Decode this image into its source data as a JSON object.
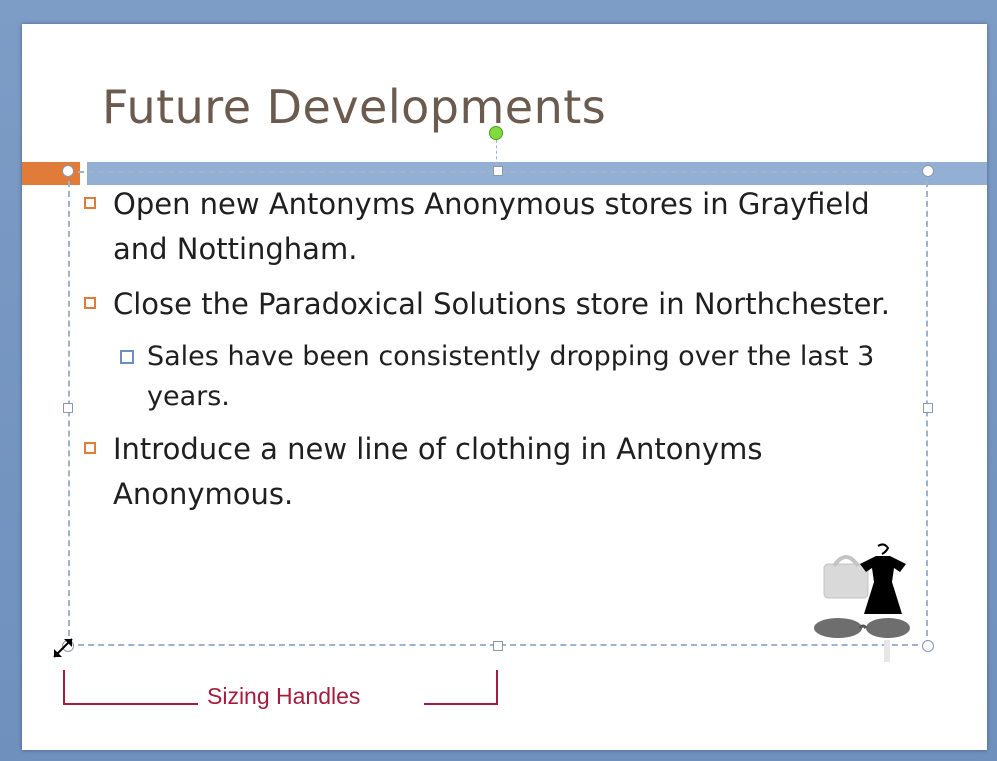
{
  "slide": {
    "title": "Future Developments",
    "bullets": [
      {
        "level": 1,
        "text": "Open new Antonyms Anonymous stores in Grayfield and Nottingham."
      },
      {
        "level": 1,
        "text": "Close the Paradoxical Solutions store in Northchester."
      },
      {
        "level": 2,
        "text": "Sales have been consistently dropping over the last 3 years."
      },
      {
        "level": 1,
        "text": "Introduce a new line of clothing in Antonyms Anonymous."
      }
    ],
    "clipart_icon": "clothing-clipart-icon"
  },
  "callout": {
    "label": "Sizing Handles"
  },
  "colors": {
    "title": "#6b5a4e",
    "accent_orange": "#e07b39",
    "accent_blue": "#93b0d4",
    "sub_bullet": "#6a8fc0",
    "callout": "#a61c3c",
    "rotate_handle": "#7fdc3a"
  },
  "icons": [
    "rotate-handle-icon",
    "resize-cursor-icon",
    "clothing-clipart-icon"
  ]
}
